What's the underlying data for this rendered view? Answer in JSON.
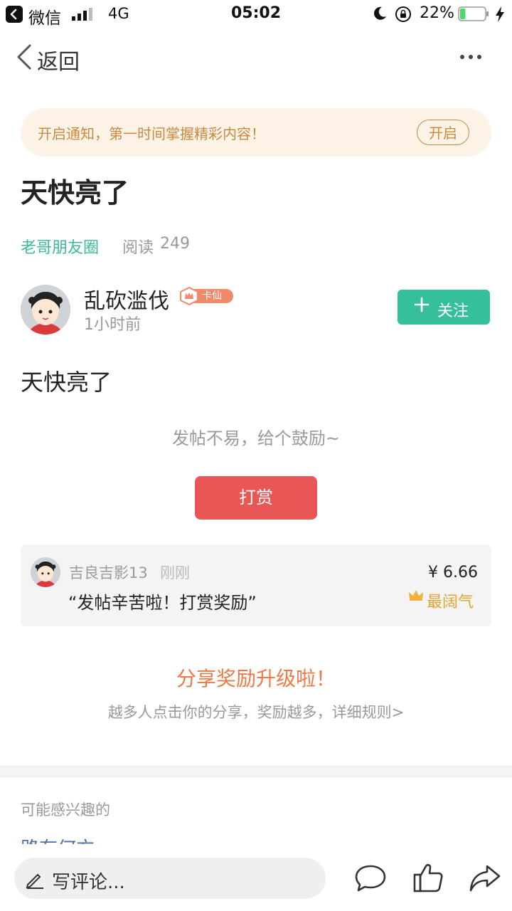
{
  "status_bar": {
    "back_app": "微信",
    "network": "4G",
    "time": "05:02",
    "battery_percent": "22%",
    "battery_level": 0.22,
    "icons": [
      "back-icon",
      "signal-icon",
      "moon-icon",
      "orientation-lock-icon",
      "battery-icon",
      "charging-icon"
    ]
  },
  "nav": {
    "back_label": "返回",
    "icons": [
      "chevron-left-icon",
      "more-icon"
    ]
  },
  "banner": {
    "text": "开启通知，第一时间掌握精彩内容！",
    "button": "开启"
  },
  "post": {
    "title": "天快亮了",
    "circle": "老哥朋友圈",
    "read_label": "阅读",
    "read_count": "249",
    "author": {
      "name": "乱砍滥伐",
      "badge": "卡仙",
      "time": "1小时前"
    },
    "follow_label": "关注",
    "content": "天快亮了"
  },
  "reward": {
    "prompt": "发帖不易，给个鼓励~",
    "button": "打赏",
    "tip": {
      "user": "吉良吉影13",
      "time": "刚刚",
      "message": "“发帖辛苦啦！打赏奖励”",
      "amount": "¥ 6.66",
      "tag": "最阔气"
    }
  },
  "share": {
    "title": "分享奖励升级啦！",
    "subtitle": "越多人点击你的分享，奖励越多，详细规则>"
  },
  "recommend": {
    "label": "可能感兴趣的",
    "first_item": "路有何方"
  },
  "bottom_bar": {
    "comment_placeholder": "写评论...",
    "icons": [
      "pen-icon",
      "comment-icon",
      "like-icon",
      "share-icon"
    ]
  },
  "colors": {
    "accent_green": "#35bf9b",
    "reward_red": "#e85656",
    "banner_bg": "#fdf2e6",
    "banner_text": "#c98a3f",
    "share_orange": "#ed7a46",
    "gold": "#e0a530"
  }
}
